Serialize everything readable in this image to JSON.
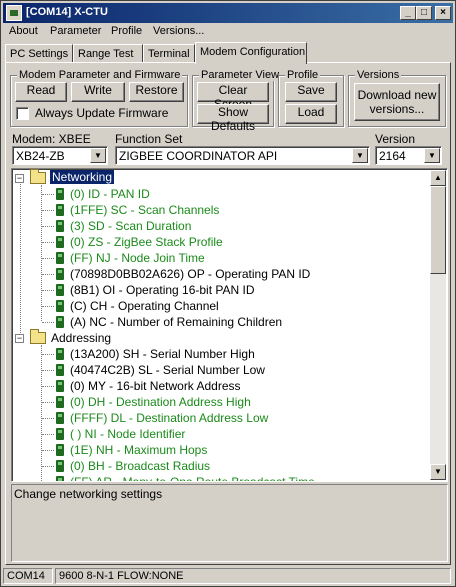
{
  "window": {
    "title": "[COM14] X-CTU"
  },
  "titlebar_buttons": {
    "minimize": "_",
    "maximize": "□",
    "close": "×"
  },
  "menu": [
    "About",
    "Parameter",
    "Profile",
    "Versions..."
  ],
  "tabs": [
    "PC Settings",
    "Range Test",
    "Terminal",
    "Modem Configuration"
  ],
  "groups": {
    "modem_param": {
      "title": "Modem Parameter and Firmware",
      "read": "Read",
      "write": "Write",
      "restore": "Restore",
      "always_update": "Always Update Firmware"
    },
    "param_view": {
      "title": "Parameter View",
      "clear": "Clear Screen",
      "defaults": "Show Defaults"
    },
    "profile": {
      "title": "Profile",
      "save": "Save",
      "load": "Load"
    },
    "versions": {
      "title": "Versions",
      "download_l1": "Download new",
      "download_l2": "versions..."
    }
  },
  "selectors": {
    "modem_label": "Modem: XBEE",
    "modem_value": "XB24-ZB",
    "function_label": "Function Set",
    "function_value": "ZIGBEE COORDINATOR API",
    "version_label": "Version",
    "version_value": "2164"
  },
  "tree": {
    "networking": {
      "label": "Networking",
      "items": [
        {
          "text": "(0) ID - PAN ID",
          "color": "green"
        },
        {
          "text": "(1FFE) SC - Scan Channels",
          "color": "green"
        },
        {
          "text": "(3) SD - Scan Duration",
          "color": "green"
        },
        {
          "text": "(0) ZS - ZigBee Stack Profile",
          "color": "green"
        },
        {
          "text": "(FF) NJ - Node Join Time",
          "color": "green"
        },
        {
          "text": "(70898D0BB02A626) OP - Operating PAN ID",
          "color": "black"
        },
        {
          "text": "(8B1) OI - Operating 16-bit PAN ID",
          "color": "black"
        },
        {
          "text": "(C) CH - Operating Channel",
          "color": "black"
        },
        {
          "text": "(A) NC - Number of Remaining Children",
          "color": "black"
        }
      ]
    },
    "addressing": {
      "label": "Addressing",
      "items": [
        {
          "text": "(13A200) SH - Serial Number High",
          "color": "black"
        },
        {
          "text": "(40474C2B) SL - Serial Number Low",
          "color": "black"
        },
        {
          "text": "(0) MY - 16-bit Network Address",
          "color": "black"
        },
        {
          "text": "(0) DH - Destination Address High",
          "color": "green"
        },
        {
          "text": "(FFFF) DL - Destination Address Low",
          "color": "green"
        },
        {
          "text": "( ) NI - Node Identifier",
          "color": "green"
        },
        {
          "text": "(1E) NH - Maximum Hops",
          "color": "green"
        },
        {
          "text": "(0) BH - Broadcast Radius",
          "color": "green"
        },
        {
          "text": "(FF) AR - Many-to-One Route Broadcast Time",
          "color": "green"
        }
      ]
    }
  },
  "description": "Change networking settings",
  "status": {
    "port": "COM14",
    "settings": "9600 8-N-1  FLOW:NONE"
  },
  "colors": {
    "green": "#1a8a1a",
    "title_bar": "#0a246a",
    "selection": "#0a246a"
  }
}
